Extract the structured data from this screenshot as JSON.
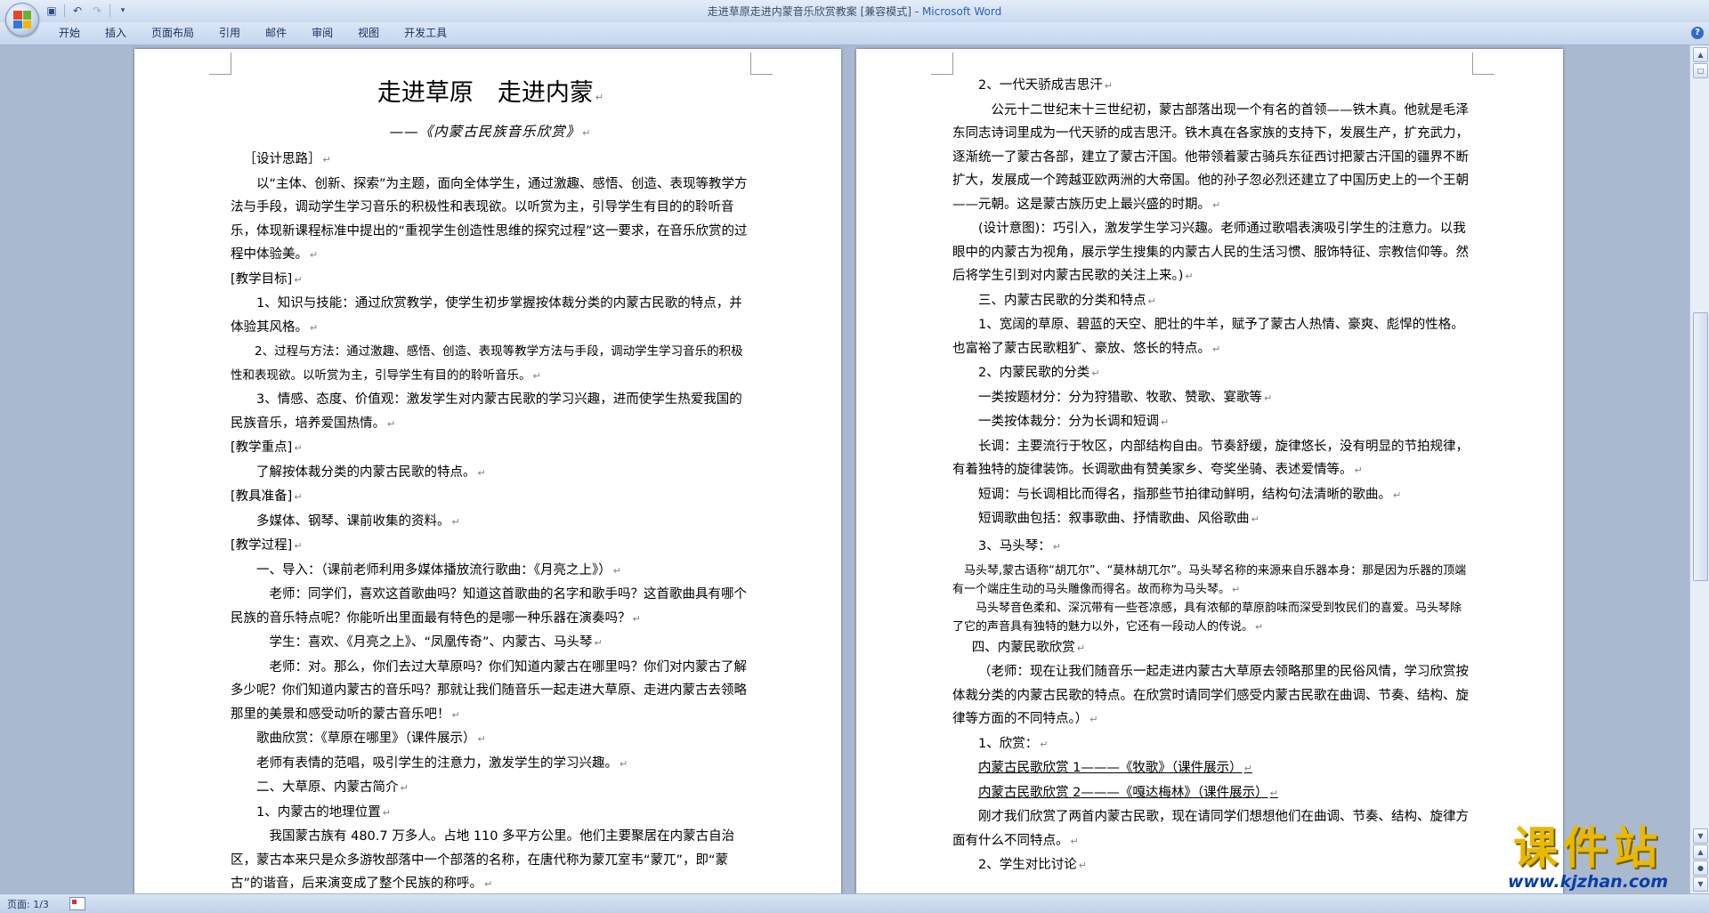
{
  "window": {
    "title": "走进草原走进内蒙音乐欣赏教案 [兼容模式] -",
    "app_name": "Microsoft Word"
  },
  "quick_access": {
    "save_icon": "save-icon",
    "undo_icon": "undo-icon",
    "redo_icon": "redo-icon",
    "customize_icon": "dropdown-arrow-icon"
  },
  "ribbon": {
    "tabs": [
      "开始",
      "插入",
      "页面布局",
      "引用",
      "邮件",
      "审阅",
      "视图",
      "开发工具"
    ]
  },
  "left_page": {
    "title": "走进草原　走进内蒙",
    "subtitle": "——《内蒙古民族音乐欣赏》",
    "paragraphs": [
      "［设计思路］",
      "以“主体、创新、探索”为主题，面向全体学生，通过激趣、感悟、创造、表现等教学方法与手段，调动学生学习音乐的积极性和表现欲。以听赏为主，引导学生有目的的聆听音乐，体现新课程标准中提出的“重视学生创造性思维的探究过程”这一要求，在音乐欣赏的过程中体验美。",
      "[教学目标]",
      "1、知识与技能：通过欣赏教学，使学生初步掌握按体裁分类的内蒙古民歌的特点，并体验其风格。",
      "2、过程与方法：通过激趣、感悟、创造、表现等教学方法与手段，调动学生学习音乐的积极性和表现欲。以听赏为主，引导学生有目的的聆听音乐。",
      "3、情感、态度、价值观：激发学生对内蒙古民歌的学习兴趣，进而使学生热爱我国的民族音乐，培养爱国热情。",
      "[教学重点]",
      "了解按体裁分类的内蒙古民歌的特点。",
      "[教具准备]",
      "多媒体、钢琴、课前收集的资料。",
      "[教学过程]",
      "一、导入：（课前老师利用多媒体播放流行歌曲：《月亮之上》）",
      "老师：同学们，喜欢这首歌曲吗？知道这首歌曲的名字和歌手吗？这首歌曲具有哪个民族的音乐特点呢？你能听出里面最有特色的是哪一种乐器在演奏吗？",
      "学生：喜欢、《月亮之上》、“凤凰传奇”、内蒙古、马头琴",
      "老师：对。那么，你们去过大草原吗？你们知道内蒙古在哪里吗？你们对内蒙古了解多少呢？你们知道内蒙古的音乐吗？那就让我们随音乐一起走进大草原、走进内蒙古去领略那里的美景和感受动听的蒙古音乐吧！",
      "歌曲欣赏：《草原在哪里》（课件展示）",
      "老师有表情的范唱，吸引学生的注意力，激发学生的学习兴趣。",
      "二、大草原、内蒙古简介",
      "1、内蒙古的地理位置",
      "我国蒙古族有 480.7 万多人。占地 110 多平方公里。他们主要聚居在内蒙古自治区，蒙古本来只是众多游牧部落中一个部落的名称，在唐代称为蒙兀室韦“蒙兀”，即“蒙古”的谐音，后来演变成了整个民族的称呼。"
    ]
  },
  "right_page": {
    "paragraphs": [
      "2、一代天骄成吉思汗",
      "公元十二世纪末十三世纪初，蒙古部落出现一个有名的首领——铁木真。他就是毛泽东同志诗词里成为一代天骄的成吉思汗。铁木真在各家族的支持下，发展生产，扩充武力，逐渐统一了蒙古各部，建立了蒙古汗国。他带领着蒙古骑兵东征西讨把蒙古汗国的疆界不断扩大，发展成一个跨越亚欧两洲的大帝国。他的孙子忽必烈还建立了中国历史上的一个王朝——元朝。这是蒙古族历史上最兴盛的时期。",
      "(设计意图)：巧引入，激发学生学习兴趣。老师通过歌唱表演吸引学生的注意力。以我眼中的内蒙古为视角，展示学生搜集的内蒙古人民的生活习惯、服饰特征、宗教信仰等。然后将学生引到对内蒙古民歌的关注上来。)",
      "三、内蒙古民歌的分类和特点",
      "1、宽阔的草原、碧蓝的天空、肥壮的牛羊，赋予了蒙古人热情、豪爽、彪悍的性格。也富裕了蒙古民歌粗犷、豪放、悠长的特点。",
      "2、内蒙民歌的分类",
      "一类按题材分：分为狩猎歌、牧歌、赞歌、宴歌等",
      "一类按体裁分：分为长调和短调",
      "长调：主要流行于牧区，内部结构自由。节奏舒缓，旋律悠长，没有明显的节拍规律，有着独特的旋律装饰。长调歌曲有赞美家乡、夸奖坐骑、表述爱情等。",
      "短调：与长调相比而得名，指那些节拍律动鲜明，结构句法清晰的歌曲。",
      "短调歌曲包括：叙事歌曲、抒情歌曲、风俗歌曲",
      "3、马头琴：",
      "马头琴,蒙古语称“胡兀尔”、“莫林胡兀尔”。马头琴名称的来源来自乐器本身：那是因为乐器的顶端有一个端庄生动的马头雕像而得名。故而称为马头琴。",
      "马头琴音色柔和、深沉带有一些苍凉感，具有浓郁的草原韵味而深受到牧民们的喜爱。马头琴除了它的声音具有独特的魅力以外，它还有一段动人的传说。",
      "四、内蒙民歌欣赏",
      "（老师：现在让我们随音乐一起走进内蒙古大草原去领略那里的民俗风情，学习欣赏按体裁分类的内蒙古民歌的特点。在欣赏时请同学们感受内蒙古民歌在曲调、节奏、结构、旋律等方面的不同特点。）",
      "1、欣赏：",
      "内蒙古民歌欣赏 1———《牧歌》（课件展示）",
      "内蒙古民歌欣赏 2———《嘎达梅林》（课件展示）",
      "刚才我们欣赏了两首内蒙古民歌，现在请同学们想想他们在曲调、节奏、结构、旋律方面有什么不同特点。",
      "2、学生对比讨论"
    ]
  },
  "status_bar": {
    "page_info": "页面: 1/3"
  },
  "watermark": {
    "brand": "课件站",
    "url": "www.kjzhan.com"
  },
  "colors": {
    "office_blue": "#2b5fb4",
    "workspace": "#a9b9cf",
    "watermark_yellow": "#e9b800"
  }
}
